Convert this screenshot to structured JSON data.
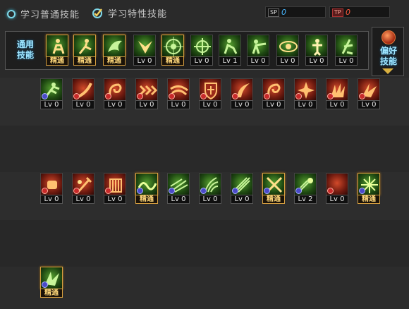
{
  "topbar": {
    "learn_normal": "学习普通技能",
    "learn_special": "学习特性技能",
    "sp_tag": "SP",
    "sp_value": "0",
    "tp_tag": "TP",
    "tp_value": "0"
  },
  "common_label": [
    "通用",
    "技能"
  ],
  "pref_label": [
    "偏好",
    "技能"
  ],
  "colors": {
    "accent": "#7fd8e8",
    "sp": "#47b6ff",
    "tp": "#ff5a3c",
    "gold": "#d8a040"
  },
  "rows": [
    [
      {
        "name": "skill-common-1",
        "icon": "crouch-figure",
        "lv": "精通",
        "gold": true,
        "color": "gold"
      },
      {
        "name": "skill-common-2",
        "icon": "leap-figure",
        "lv": "精通",
        "gold": true,
        "color": "gold"
      },
      {
        "name": "skill-common-3",
        "icon": "dragon",
        "lv": "精通",
        "gold": true,
        "color": "green"
      },
      {
        "name": "skill-common-4",
        "icon": "wings",
        "lv": "Lv 0",
        "gold": false,
        "color": "green"
      },
      {
        "name": "skill-common-5",
        "icon": "target",
        "lv": "精通",
        "gold": true,
        "color": "green"
      },
      {
        "name": "skill-common-6",
        "icon": "crosshair",
        "lv": "Lv 0",
        "gold": false,
        "color": "green"
      },
      {
        "name": "skill-common-7",
        "icon": "kneel-figure",
        "lv": "Lv 1",
        "gold": false,
        "color": "green"
      },
      {
        "name": "skill-common-8",
        "icon": "punch-figure",
        "lv": "Lv 0",
        "gold": false,
        "color": "green"
      },
      {
        "name": "skill-common-9",
        "icon": "eye",
        "lv": "Lv 0",
        "gold": false,
        "color": "green"
      },
      {
        "name": "skill-common-10",
        "icon": "glow-figure",
        "lv": "Lv 0",
        "gold": false,
        "color": "gold"
      },
      {
        "name": "skill-common-11",
        "icon": "rune",
        "lv": "Lv 0",
        "gold": false,
        "color": "green"
      }
    ],
    [
      {
        "name": "skill-r2-1",
        "icon": "runner",
        "lv": "Lv 0",
        "gold": false,
        "color": "green",
        "ex": true
      },
      {
        "name": "skill-r2-2",
        "icon": "slash",
        "lv": "Lv 0",
        "gold": false,
        "color": "red",
        "ex": true
      },
      {
        "name": "skill-r2-3",
        "icon": "swirl",
        "lv": "Lv 0",
        "gold": false,
        "color": "red",
        "ex": true
      },
      {
        "name": "skill-r2-4",
        "icon": "chevrons",
        "lv": "Lv 0",
        "gold": false,
        "color": "red",
        "ex": true
      },
      {
        "name": "skill-r2-5",
        "icon": "sweep",
        "lv": "Lv 0",
        "gold": false,
        "color": "red",
        "ex": true
      },
      {
        "name": "skill-r2-6",
        "icon": "shield-cross",
        "lv": "Lv 0",
        "gold": false,
        "color": "red",
        "ex": true
      },
      {
        "name": "skill-r2-7",
        "icon": "crescent-slash",
        "lv": "Lv 0",
        "gold": false,
        "color": "red",
        "ex": true
      },
      {
        "name": "skill-r2-8",
        "icon": "swirl",
        "lv": "Lv 0",
        "gold": false,
        "color": "red",
        "ex": true
      },
      {
        "name": "skill-r2-9",
        "icon": "burst",
        "lv": "Lv 0",
        "gold": false,
        "color": "red",
        "ex": true
      },
      {
        "name": "skill-r2-10",
        "icon": "spikes",
        "lv": "Lv 0",
        "gold": false,
        "color": "red",
        "ex": true
      },
      {
        "name": "skill-r2-11",
        "icon": "shards",
        "lv": "Lv 0",
        "gold": false,
        "color": "red",
        "ex": true
      }
    ],
    [
      {
        "name": "skill-r3-1",
        "icon": "fist",
        "lv": "Lv 0",
        "gold": false,
        "color": "red",
        "ex": true
      },
      {
        "name": "skill-r3-2",
        "icon": "sword-fire",
        "lv": "Lv 0",
        "gold": false,
        "color": "red",
        "ex": true
      },
      {
        "name": "skill-r3-3",
        "icon": "gate",
        "lv": "Lv 0",
        "gold": false,
        "color": "red",
        "ex": true
      },
      {
        "name": "skill-r3-4",
        "icon": "wave",
        "lv": "精通",
        "gold": true,
        "color": "green",
        "ex": true
      },
      {
        "name": "skill-r3-5",
        "icon": "streaks",
        "lv": "Lv 0",
        "gold": false,
        "color": "green",
        "ex": true
      },
      {
        "name": "skill-r3-6",
        "icon": "claw",
        "lv": "Lv 0",
        "gold": false,
        "color": "green",
        "ex": true
      },
      {
        "name": "skill-r3-7",
        "icon": "rays",
        "lv": "Lv 0",
        "gold": false,
        "color": "green",
        "ex": true
      },
      {
        "name": "skill-r3-8",
        "icon": "cross-swords",
        "lv": "精通",
        "gold": true,
        "color": "green",
        "ex": true
      },
      {
        "name": "skill-r3-9",
        "icon": "comet",
        "lv": "Lv 2",
        "gold": false,
        "color": "green",
        "ex": true
      },
      {
        "name": "skill-r3-10",
        "icon": "moon",
        "lv": "Lv 0",
        "gold": false,
        "color": "red",
        "ex": true
      },
      {
        "name": "skill-r3-11",
        "icon": "snowflake",
        "lv": "精通",
        "gold": true,
        "color": "green",
        "ex": true
      }
    ],
    [
      {
        "name": "skill-r4-1",
        "icon": "splash",
        "lv": "精通",
        "gold": true,
        "color": "green",
        "ex": true
      }
    ]
  ]
}
